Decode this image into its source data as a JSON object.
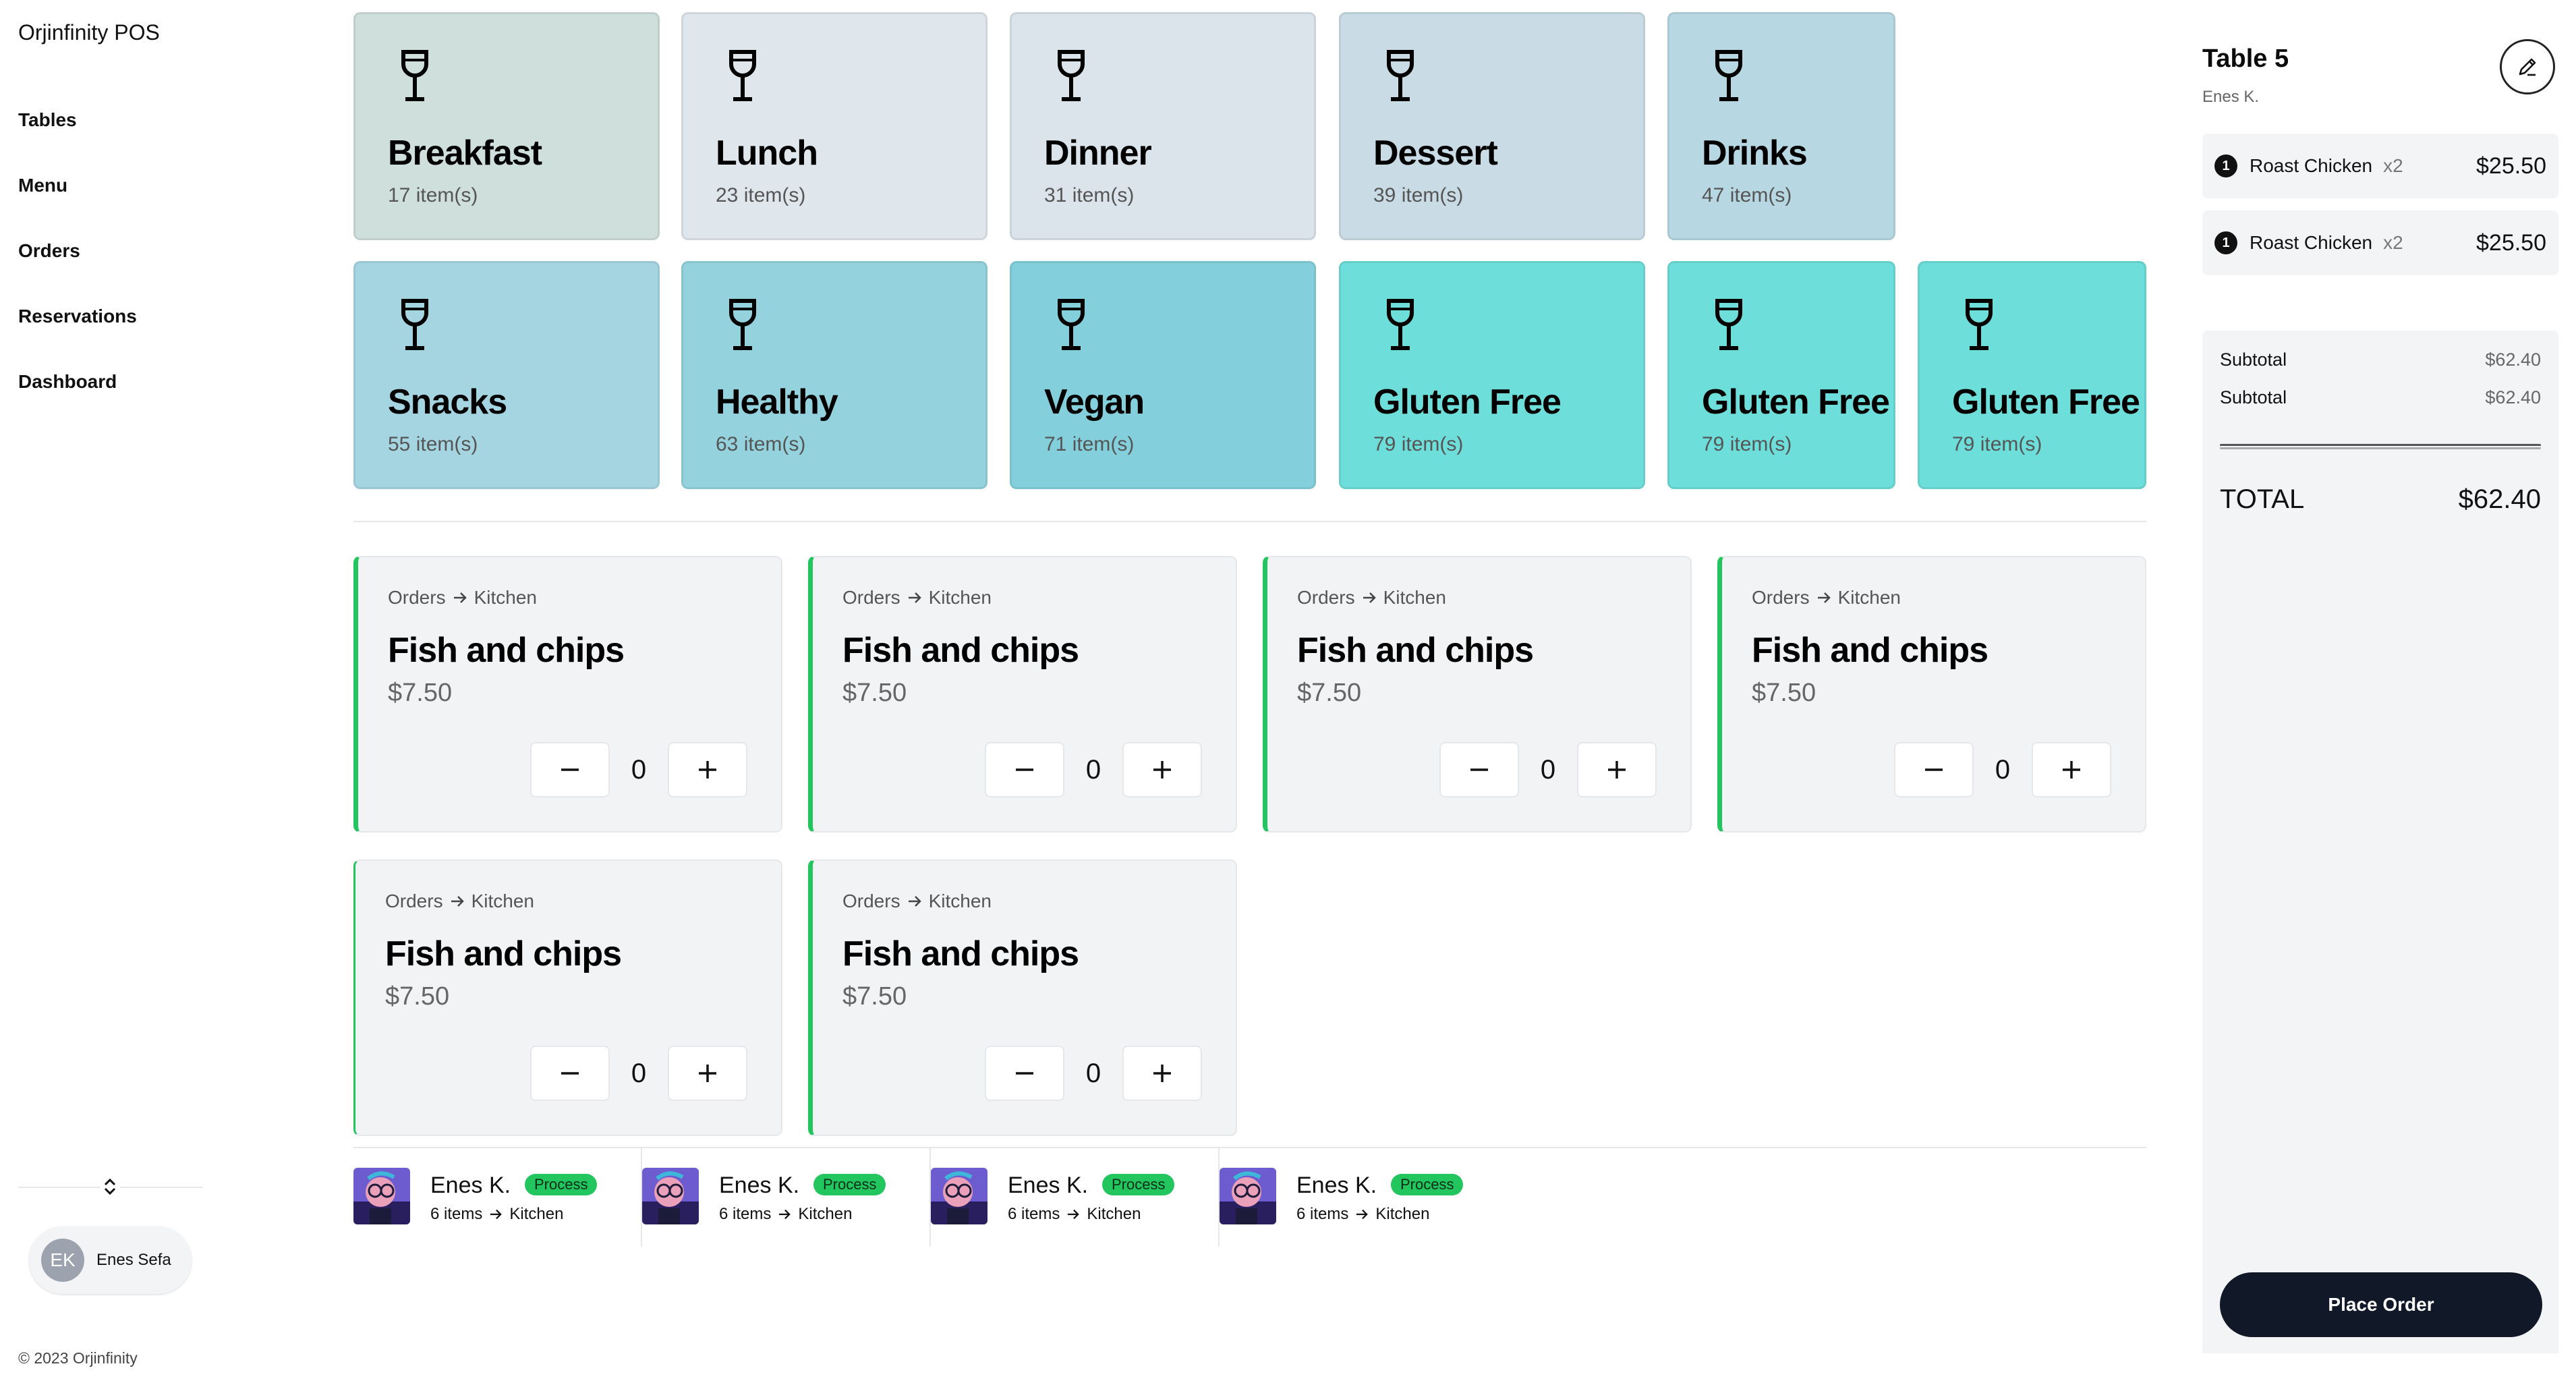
{
  "app": {
    "title": "Orjinfinity POS",
    "copyright": "© 2023 Orjinfinity"
  },
  "sidebar": {
    "items": [
      {
        "label": "Tables"
      },
      {
        "label": "Menu"
      },
      {
        "label": "Orders"
      },
      {
        "label": "Reservations"
      },
      {
        "label": "Dashboard"
      }
    ],
    "toggle_icon": "chevron-up-down-icon",
    "user": {
      "initials": "EK",
      "name": "Enes Sefa"
    }
  },
  "categories": [
    {
      "name": "Breakfast",
      "count": "17 item(s)",
      "color": "#cfdfdc",
      "icon": "wine-glass-icon"
    },
    {
      "name": "Lunch",
      "count": "23 item(s)",
      "color": "#dfe6ec",
      "icon": "wine-glass-icon"
    },
    {
      "name": "Dinner",
      "count": "31 item(s)",
      "color": "#dae4ea",
      "icon": "wine-glass-icon"
    },
    {
      "name": "Dessert",
      "count": "39 item(s)",
      "color": "#c9dbe5",
      "icon": "wine-glass-icon"
    },
    {
      "name": "Drinks",
      "count": "47 item(s)",
      "color": "#b7d8e2",
      "icon": "wine-glass-icon"
    },
    {
      "name": "Snacks",
      "count": "55 item(s)",
      "color": "#a6d5e2",
      "icon": "wine-glass-icon"
    },
    {
      "name": "Healthy",
      "count": "63 item(s)",
      "color": "#94d3de",
      "icon": "wine-glass-icon"
    },
    {
      "name": "Vegan",
      "count": "71 item(s)",
      "color": "#83d0dc",
      "icon": "wine-glass-icon"
    },
    {
      "name": "Gluten Free",
      "count": "79 item(s)",
      "color": "#6ddeda",
      "icon": "wine-glass-icon"
    },
    {
      "name": "Gluten Free",
      "count": "79 item(s)",
      "color": "#6ddeda",
      "icon": "wine-glass-icon"
    },
    {
      "name": "Gluten Free",
      "count": "79 item(s)",
      "color": "#6ddeda",
      "icon": "wine-glass-icon"
    }
  ],
  "products": [
    {
      "crumb_from": "Orders",
      "crumb_to": "Kitchen",
      "name": "Fish and chips",
      "price": "$7.50",
      "qty": "0"
    },
    {
      "crumb_from": "Orders",
      "crumb_to": "Kitchen",
      "name": "Fish and chips",
      "price": "$7.50",
      "qty": "0"
    },
    {
      "crumb_from": "Orders",
      "crumb_to": "Kitchen",
      "name": "Fish and chips",
      "price": "$7.50",
      "qty": "0"
    },
    {
      "crumb_from": "Orders",
      "crumb_to": "Kitchen",
      "name": "Fish and chips",
      "price": "$7.50",
      "qty": "0"
    },
    {
      "crumb_from": "Orders",
      "crumb_to": "Kitchen",
      "name": "Fish and chips",
      "price": "$7.50",
      "qty": "0"
    },
    {
      "crumb_from": "Orders",
      "crumb_to": "Kitchen",
      "name": "Fish and chips",
      "price": "$7.50",
      "qty": "0"
    }
  ],
  "orders": [
    {
      "name": "Enes K.",
      "status": "Process",
      "items": "6 items",
      "dest": "Kitchen"
    },
    {
      "name": "Enes K.",
      "status": "Process",
      "items": "6 items",
      "dest": "Kitchen"
    },
    {
      "name": "Enes K.",
      "status": "Process",
      "items": "6 items",
      "dest": "Kitchen"
    },
    {
      "name": "Enes K.",
      "status": "Process",
      "items": "6 items",
      "dest": "Kitchen"
    }
  ],
  "order_panel": {
    "table": "Table 5",
    "waiter": "Enes K.",
    "line_items": [
      {
        "num": "1",
        "name": "Roast Chicken",
        "qty": "x2",
        "price": "$25.50"
      },
      {
        "num": "1",
        "name": "Roast Chicken",
        "qty": "x2",
        "price": "$25.50"
      }
    ],
    "summary": [
      {
        "label": "Subtotal",
        "value": "$62.40"
      },
      {
        "label": "Subtotal",
        "value": "$62.40"
      }
    ],
    "total_label": "TOTAL",
    "total_value": "$62.40",
    "place_order": "Place Order"
  }
}
